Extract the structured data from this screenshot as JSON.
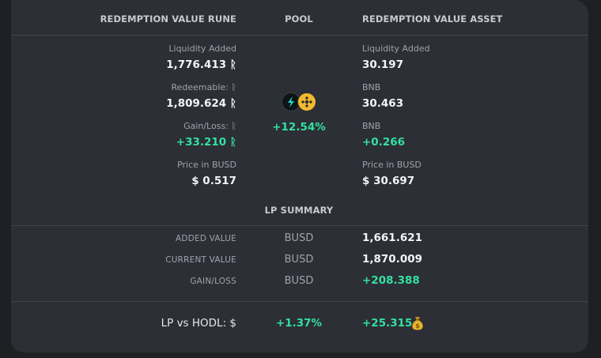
{
  "headers": {
    "rune": "REDEMPTION VALUE RUNE",
    "pool": "POOL",
    "asset": "REDEMPTION VALUE ASSET"
  },
  "rune": {
    "liquidity_label": "Liquidity Added",
    "liquidity_value": "1,776.413 ᚱ",
    "redeemable_label": "Redeemable: ᚱ",
    "redeemable_value": "1,809.624 ᚱ",
    "gain_label": "Gain/Loss: ᚱ",
    "gain_value": "+33.210 ᚱ",
    "price_label": "Price in BUSD",
    "price_value": "$ 0.517"
  },
  "pool": {
    "icons": [
      "thorchain-rune-icon",
      "bnb-icon"
    ],
    "colors": {
      "rune_bg": "#0d1416",
      "rune_accent": "#23dcc8",
      "bnb": "#f3ba2f"
    },
    "change": "+12.54%"
  },
  "asset": {
    "liquidity_label": "Liquidity Added",
    "liquidity_value": "30.197",
    "asset_label": "BNB",
    "asset_value": "30.463",
    "gain_label": "BNB",
    "gain_value": "+0.266",
    "price_label": "Price in BUSD",
    "price_value": "$ 30.697"
  },
  "summary": {
    "title": "LP SUMMARY",
    "rows": [
      {
        "label": "ADDED VALUE",
        "unit": "BUSD",
        "value": "1,661.621"
      },
      {
        "label": "CURRENT VALUE",
        "unit": "BUSD",
        "value": "1,870.009"
      },
      {
        "label": "GAIN/LOSS",
        "unit": "BUSD",
        "value": "+208.388"
      }
    ]
  },
  "hodl": {
    "label": "LP vs HODL: $",
    "percent": "+1.37%",
    "value": "+25.315",
    "icon": "money-bag-icon"
  },
  "colors": {
    "positive": "#33e0a1",
    "card": "#2c2f35",
    "background": "#1e2024"
  }
}
